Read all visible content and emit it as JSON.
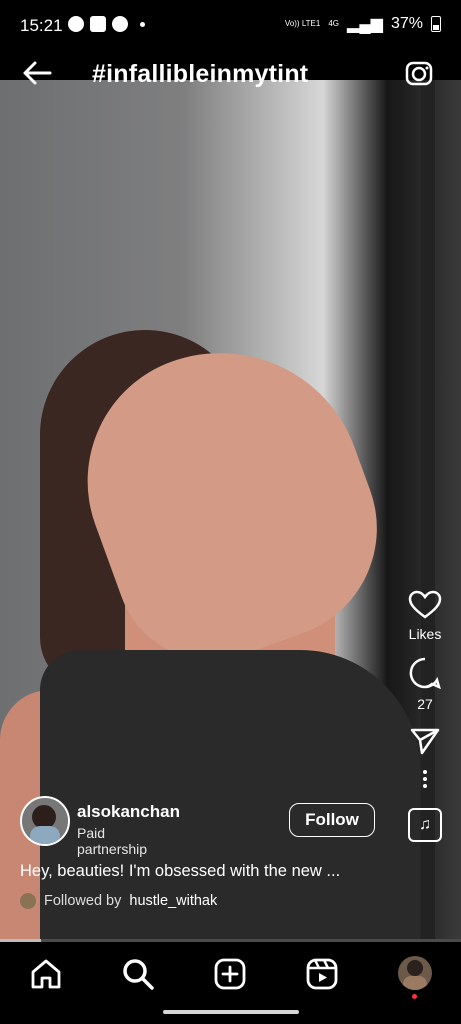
{
  "status_bar": {
    "time": "15:21",
    "network": "4G",
    "volte": "Vo))\nLTE1",
    "battery": "37%"
  },
  "header": {
    "title": "#infallibleinmytint",
    "back_icon": "arrow-left-icon",
    "camera_icon": "camera-icon"
  },
  "reel": {
    "username": "alsokanchan",
    "subtitle": "Paid partnership",
    "follow_label": "Follow",
    "caption": "Hey, beauties! I'm obsessed with the new ...",
    "followed_prefix": "Followed by",
    "followed_user": "hustle_withak",
    "progress": 0.09
  },
  "actions": {
    "likes_label": "Likes",
    "comments_count": "27"
  },
  "bottom_nav": {
    "items": [
      "home-icon",
      "search-icon",
      "create-icon",
      "reels-icon",
      "profile-avatar"
    ]
  }
}
